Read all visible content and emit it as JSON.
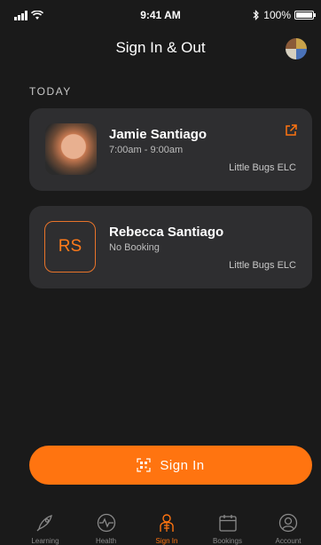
{
  "status_bar": {
    "time": "9:41 AM",
    "battery": "100%"
  },
  "header": {
    "title": "Sign In & Out"
  },
  "section": {
    "label": "TODAY"
  },
  "children": [
    {
      "name": "Jamie Santiago",
      "subtitle": "7:00am - 9:00am",
      "centre": "Little Bugs ELC",
      "avatar": "photo",
      "icon": "external-link-icon"
    },
    {
      "name": "Rebecca Santiago",
      "subtitle": "No Booking",
      "centre": "Little Bugs ELC",
      "initials": "RS"
    }
  ],
  "action": {
    "label": "Sign In",
    "icon": "qr-code-icon"
  },
  "tabs": [
    {
      "label": "Learning",
      "icon": "rocket-icon",
      "active": false
    },
    {
      "label": "Health",
      "icon": "heartbeat-icon",
      "active": false
    },
    {
      "label": "Sign In",
      "icon": "child-icon",
      "active": true
    },
    {
      "label": "Bookings",
      "icon": "calendar-icon",
      "active": false
    },
    {
      "label": "Account",
      "icon": "account-icon",
      "active": false
    }
  ],
  "colors": {
    "accent": "#ff7410",
    "background": "#1a1a1a",
    "card": "#2e2e30"
  }
}
